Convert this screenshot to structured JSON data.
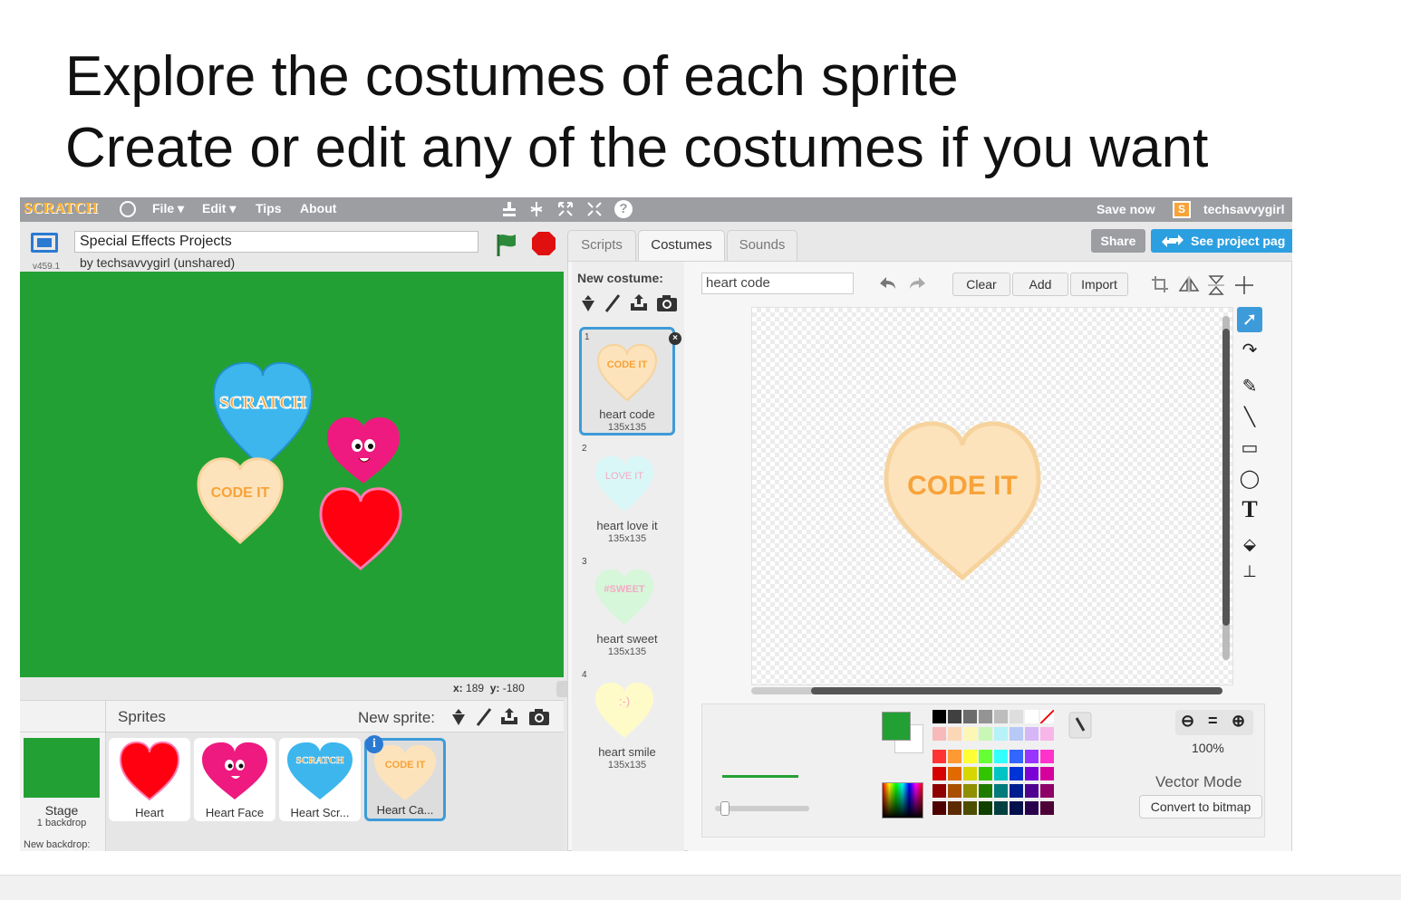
{
  "slide": {
    "line1": "Explore the costumes of each sprite",
    "line2": "Create or edit any of the costumes if you want"
  },
  "menubar": {
    "logo": "SCRATCH",
    "items": [
      "File ▾",
      "Edit ▾",
      "Tips",
      "About"
    ],
    "save_now": "Save now",
    "username": "techsavvygirl"
  },
  "project": {
    "title": "Special Effects Projects",
    "byline": "by techsavvygirl (unshared)",
    "version": "v459.1"
  },
  "stage": {
    "coords_x_label": "x:",
    "coords_x": "189",
    "coords_y_label": "y:",
    "coords_y": "-180"
  },
  "sprites": {
    "header": "Sprites",
    "new_sprite_label": "New sprite:",
    "stage_label": "Stage",
    "stage_sub": "1 backdrop",
    "new_backdrop": "New backdrop:",
    "items": [
      {
        "label": "Heart"
      },
      {
        "label": "Heart Face"
      },
      {
        "label": "Heart Scr..."
      },
      {
        "label": "Heart Ca..."
      }
    ]
  },
  "tabs": [
    "Scripts",
    "Costumes",
    "Sounds"
  ],
  "share": {
    "share_label": "Share",
    "see_project": "See project pag"
  },
  "costumes": {
    "new_costume_label": "New costume:",
    "items": [
      {
        "index": "1",
        "name": "heart code",
        "size": "135x135",
        "text": "CODE IT"
      },
      {
        "index": "2",
        "name": "heart love it",
        "size": "135x135",
        "text": "LOVE IT"
      },
      {
        "index": "3",
        "name": "heart sweet",
        "size": "135x135",
        "text": "#SWEET"
      },
      {
        "index": "4",
        "name": "heart smile",
        "size": "135x135",
        "text": ":-)"
      }
    ]
  },
  "editor": {
    "costume_name": "heart code",
    "clear": "Clear",
    "add": "Add",
    "import": "Import",
    "canvas_text": "CODE IT",
    "zoom": "100%",
    "mode": "Vector Mode",
    "convert": "Convert to bitmap",
    "equals": "="
  },
  "stage_sprites": {
    "scratch_heart_text": "SCRATCH",
    "code_heart_text": "CODE IT",
    "tile_scratch_text": "SCRATCH",
    "tile_code_text": "CODE IT"
  },
  "colors": {
    "stage_green": "#23a034",
    "selected_blue": "#3e9bd9",
    "heart_red": "#ff0010",
    "heart_pink": "#ee1a80",
    "heart_blue": "#3db6ee",
    "heart_peach": "#fde3bb",
    "code_orange": "#f7a339",
    "share_blue": "#2c9fe0",
    "share_gray": "#9c9ea2"
  }
}
